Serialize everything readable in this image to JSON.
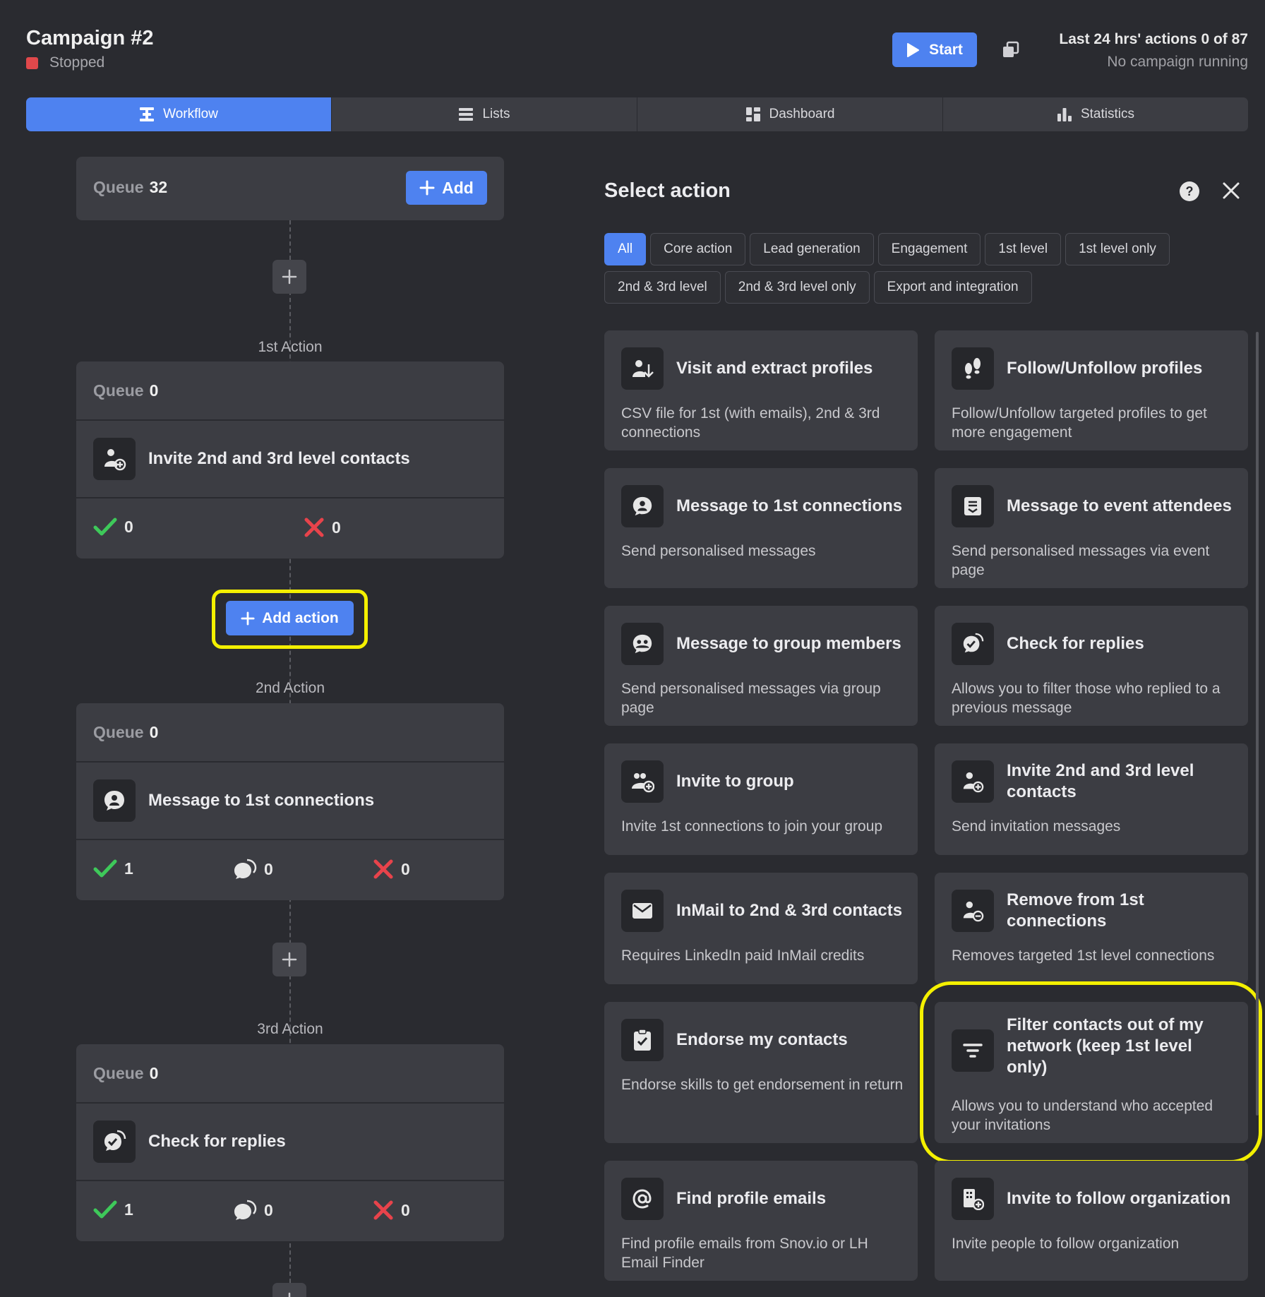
{
  "header": {
    "campaign_title": "Campaign #2",
    "status": "Stopped",
    "status_color": "#e0484b",
    "start_label": "Start",
    "last24": "Last 24 hrs' actions 0 of 87",
    "running": "No campaign running"
  },
  "tabs": [
    {
      "label": "Workflow",
      "icon": "workflow-icon",
      "active": true
    },
    {
      "label": "Lists",
      "icon": "list-icon",
      "active": false
    },
    {
      "label": "Dashboard",
      "icon": "dashboard-icon",
      "active": false
    },
    {
      "label": "Statistics",
      "icon": "bar-chart-icon",
      "active": false
    }
  ],
  "workflow": {
    "queue_label": "Queue",
    "queue_count": "32",
    "add_label": "Add",
    "add_action_label": "Add action",
    "actions": [
      {
        "step": "1st Action",
        "queue": "0",
        "title": "Invite 2nd and 3rd level contacts",
        "icon": "invite-person-icon",
        "success": "0",
        "replies": null,
        "failed": "0"
      },
      {
        "step": "2nd Action",
        "queue": "0",
        "title": "Message to 1st connections",
        "icon": "message-person-icon",
        "success": "1",
        "replies": "0",
        "failed": "0"
      },
      {
        "step": "3rd Action",
        "queue": "0",
        "title": "Check for replies",
        "icon": "check-replies-icon",
        "success": "1",
        "replies": "0",
        "failed": "0"
      }
    ]
  },
  "panel": {
    "title": "Select action",
    "filters": [
      "All",
      "Core action",
      "Lead generation",
      "Engagement",
      "1st level",
      "1st level only",
      "2nd & 3rd level",
      "2nd & 3rd level only",
      "Export and integration"
    ],
    "active_filter": "All",
    "cards": [
      {
        "title": "Visit and extract profiles",
        "desc": "CSV file for 1st (with emails), 2nd & 3rd connections",
        "icon": "visit-extract-icon"
      },
      {
        "title": "Follow/Unfollow profiles",
        "desc": "Follow/Unfollow targeted profiles to get more engagement",
        "icon": "footprints-icon"
      },
      {
        "title": "Message to 1st connections",
        "desc": "Send personalised messages",
        "icon": "message-person-icon"
      },
      {
        "title": "Message to event attendees",
        "desc": "Send personalised messages via event page",
        "icon": "event-message-icon"
      },
      {
        "title": "Message to group members",
        "desc": "Send personalised messages via group page",
        "icon": "group-message-icon"
      },
      {
        "title": "Check for replies",
        "desc": "Allows you to filter those who replied to a previous message",
        "icon": "check-replies-icon"
      },
      {
        "title": "Invite to group",
        "desc": "Invite 1st connections to join your group",
        "icon": "invite-group-icon"
      },
      {
        "title": "Invite 2nd and 3rd level contacts",
        "desc": "Send invitation messages",
        "icon": "invite-person-icon"
      },
      {
        "title": "InMail to 2nd & 3rd contacts",
        "desc": "Requires LinkedIn paid InMail credits",
        "icon": "mail-icon"
      },
      {
        "title": "Remove from 1st connections",
        "desc": "Removes targeted 1st level connections",
        "icon": "remove-person-icon"
      },
      {
        "title": "Endorse my contacts",
        "desc": "Endorse skills to get endorsement in return",
        "icon": "clipboard-check-icon"
      },
      {
        "title": "Filter contacts out of my network (keep 1st level only)",
        "desc": "Allows you to understand who accepted your invitations",
        "icon": "filter-icon"
      },
      {
        "title": "Find profile emails",
        "desc": "Find profile emails from Snov.io or LH Email Finder",
        "icon": "at-icon"
      },
      {
        "title": "Invite to follow organization",
        "desc": "Invite people to follow organization",
        "icon": "organization-add-icon"
      }
    ]
  },
  "colors": {
    "accent": "#4e82f0",
    "success": "#3ec95a",
    "failure": "#e8434b",
    "highlight": "#f4f000"
  }
}
